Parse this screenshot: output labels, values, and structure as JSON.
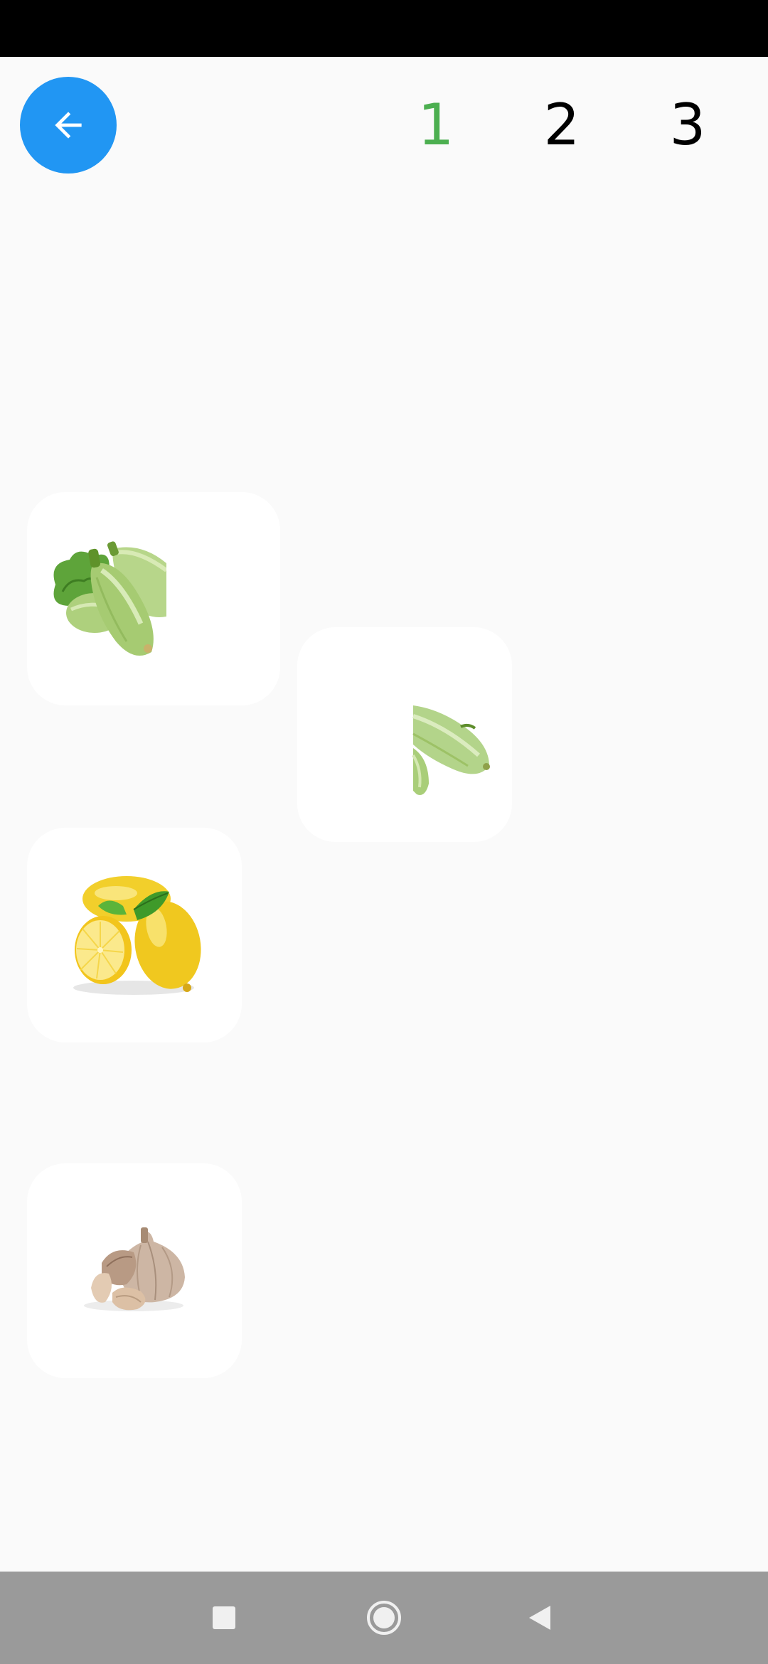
{
  "header": {
    "back_icon": "arrow-left-icon",
    "accent_color": "#2196f3",
    "levels": [
      {
        "label": "1",
        "active": true,
        "color": "#4caf50"
      },
      {
        "label": "2",
        "active": false,
        "color": "#000000"
      },
      {
        "label": "3",
        "active": false,
        "color": "#000000"
      }
    ]
  },
  "puzzle": {
    "pieces": [
      {
        "item": "zucchini",
        "piece": "left-half"
      },
      {
        "item": "zucchini",
        "piece": "right-half"
      },
      {
        "item": "lemon",
        "piece": "whole"
      },
      {
        "item": "garlic",
        "piece": "whole"
      }
    ]
  },
  "system_nav": {
    "icons": [
      "square-recents-icon",
      "circle-home-icon",
      "triangle-back-icon"
    ]
  }
}
